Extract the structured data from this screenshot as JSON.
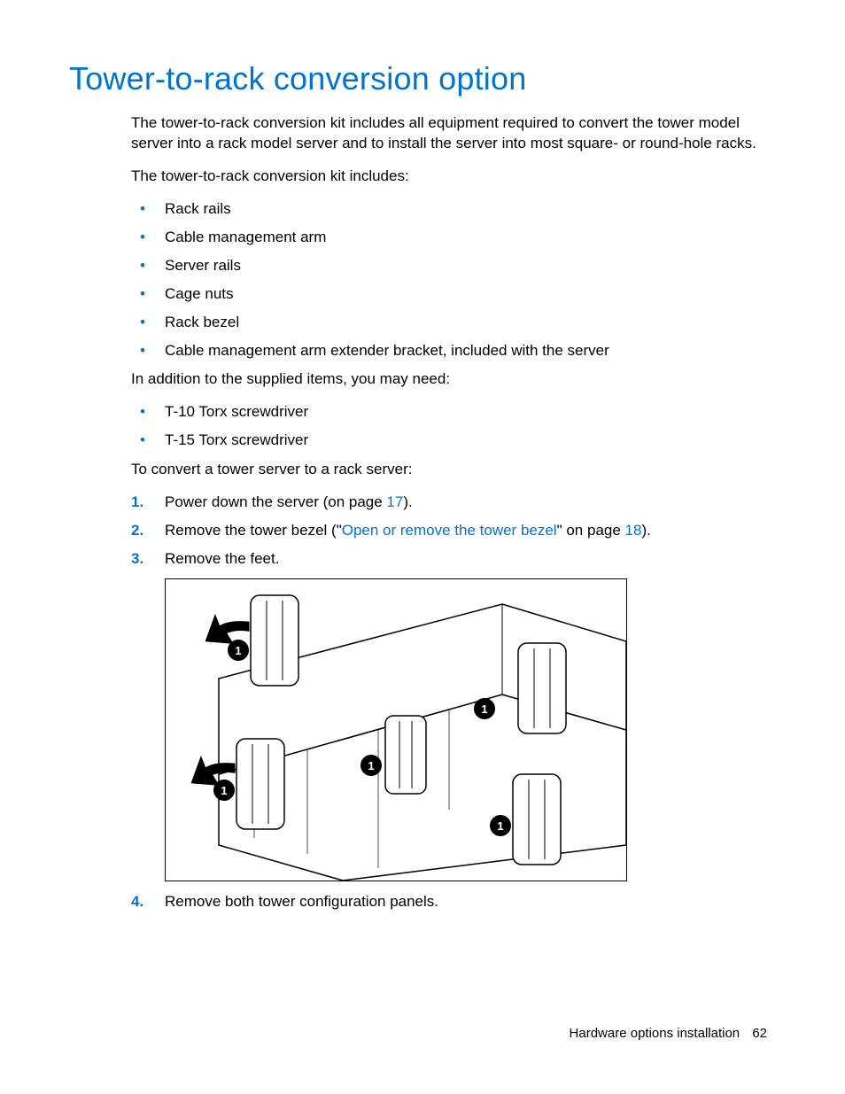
{
  "title": "Tower-to-rack conversion option",
  "paras": {
    "intro1": "The tower-to-rack conversion kit includes all equipment required to convert the tower model server into a rack model server and to install the server into most square- or round-hole racks.",
    "intro2": "The tower-to-rack conversion kit includes:",
    "addition": "In addition to the supplied items, you may need:",
    "convert": "To convert a tower server to a rack server:"
  },
  "kit_items": [
    "Rack rails",
    "Cable management arm",
    "Server rails",
    "Cage nuts",
    "Rack bezel",
    "Cable management arm extender bracket, included with the server"
  ],
  "tools": [
    "T-10 Torx screwdriver",
    "T-15 Torx screwdriver"
  ],
  "steps": {
    "s1a": "Power down the server (on page ",
    "s1link": "17",
    "s1b": ").",
    "s2a": "Remove the tower bezel (\"",
    "s2link1": "Open or remove the tower bezel",
    "s2mid": "\" on page ",
    "s2link2": "18",
    "s2b": ").",
    "s3": "Remove the feet.",
    "s4": "Remove both tower configuration panels."
  },
  "figure_label": "1",
  "footer": {
    "section": "Hardware options installation",
    "page": "62"
  }
}
